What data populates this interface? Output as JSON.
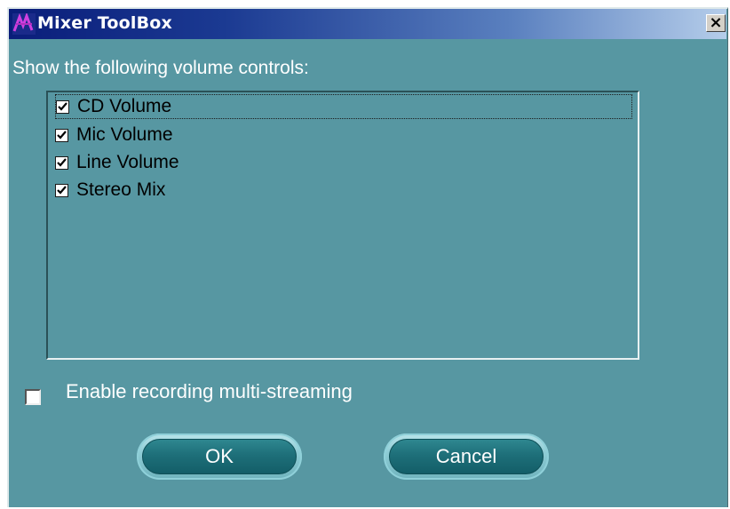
{
  "window": {
    "title": "Mixer ToolBox",
    "close_label": "×",
    "app_icon": "mixer-app-icon"
  },
  "prompt_text": "Show the following volume controls:",
  "volume_controls": [
    {
      "label": "CD Volume",
      "checked": true,
      "focused": true
    },
    {
      "label": "Mic Volume",
      "checked": true,
      "focused": false
    },
    {
      "label": "Line Volume",
      "checked": true,
      "focused": false
    },
    {
      "label": "Stereo Mix",
      "checked": true,
      "focused": false
    }
  ],
  "multistreaming": {
    "label": "Enable recording multi-streaming",
    "checked": false
  },
  "buttons": {
    "ok_label": "OK",
    "cancel_label": "Cancel"
  },
  "colors": {
    "dialog_bg": "#5797a2",
    "title_start": "#0a1d7a",
    "title_end": "#b5cdea",
    "button_face": "#1e6f79"
  }
}
